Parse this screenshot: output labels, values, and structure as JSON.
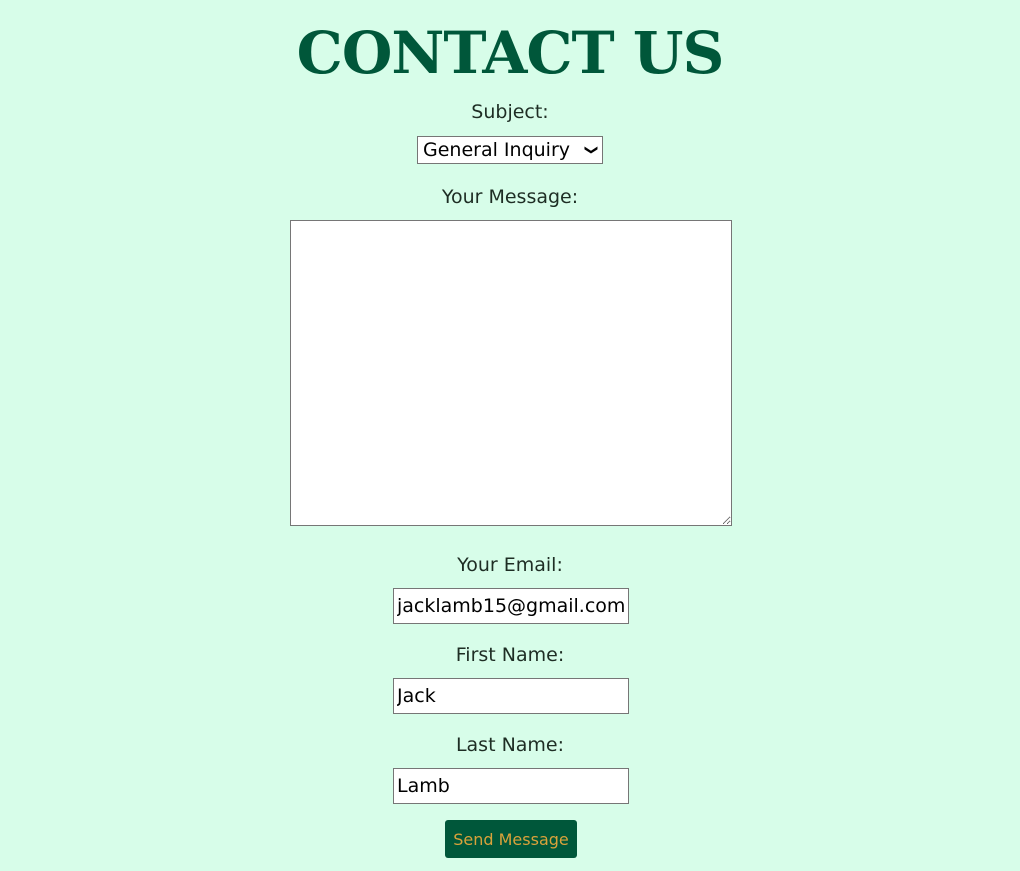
{
  "title": "CONTACT US",
  "subject": {
    "label": "Subject:",
    "selected": "General Inquiry"
  },
  "message": {
    "label": "Your Message:",
    "value": ""
  },
  "email": {
    "label": "Your Email:",
    "value": "jacklamb15@gmail.com"
  },
  "first_name": {
    "label": "First Name:",
    "value": "Jack"
  },
  "last_name": {
    "label": "Last Name:",
    "value": "Lamb"
  },
  "submit_label": "Send Message",
  "colors": {
    "background": "#d7fde9",
    "brand": "#00573a",
    "button_text": "#d9a23a"
  }
}
